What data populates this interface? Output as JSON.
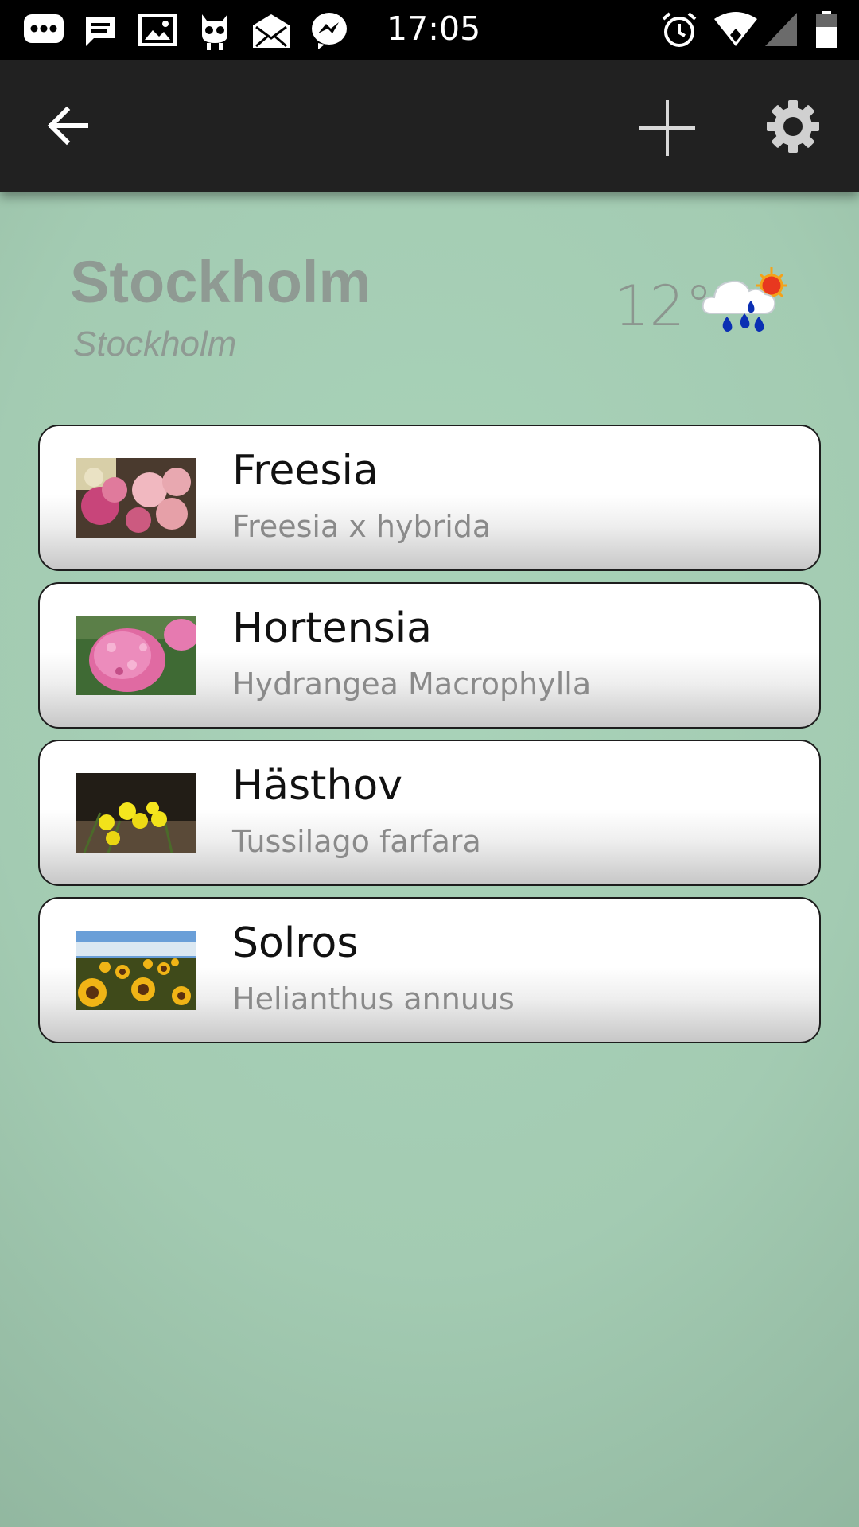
{
  "status_bar": {
    "time": "17:05",
    "icons": [
      "more-chat-icon",
      "message-icon",
      "image-icon",
      "cyanogen-icon",
      "mail-icon",
      "messenger-icon",
      "alarm-icon",
      "wifi-icon",
      "signal-icon",
      "battery-icon"
    ]
  },
  "toolbar": {
    "icons": [
      "back-arrow-icon",
      "plus-icon",
      "gear-icon"
    ]
  },
  "location": {
    "city": "Stockholm",
    "region": "Stockholm",
    "temperature": "12°",
    "weather_icon": "rain-cloud-sun-icon"
  },
  "plants": [
    {
      "name": "Freesia",
      "latin": "Freesia x hybrida"
    },
    {
      "name": "Hortensia",
      "latin": "Hydrangea Macrophylla"
    },
    {
      "name": "Hästhov",
      "latin": "Tussilago farfara"
    },
    {
      "name": "Solros",
      "latin": "Helianthus annuus"
    }
  ],
  "colors": {
    "background": "#a9d3b9",
    "toolbar": "#212121",
    "status_bar": "#000000"
  }
}
